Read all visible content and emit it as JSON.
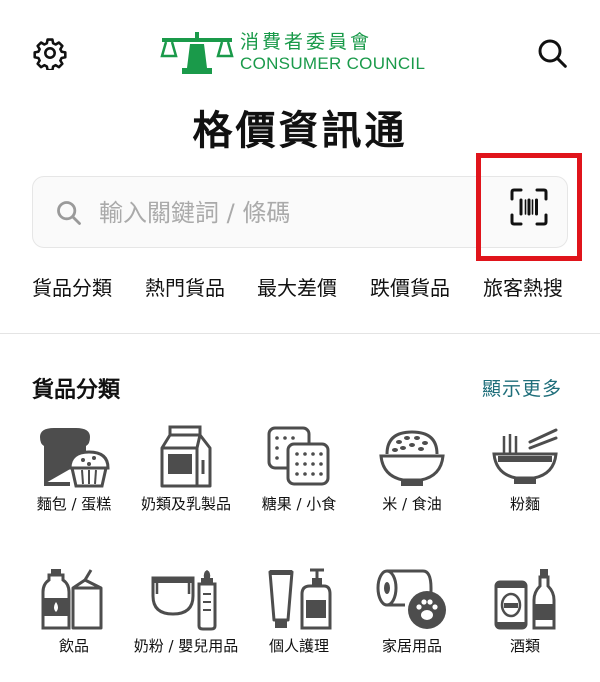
{
  "header": {
    "logo_zh": "消費者委員會",
    "logo_en": "CONSUMER COUNCIL",
    "title": "格價資訊通"
  },
  "search": {
    "placeholder": "輸入關鍵詞 / 條碼"
  },
  "tabs": [
    {
      "label": "貨品分類"
    },
    {
      "label": "熱門貨品"
    },
    {
      "label": "最大差價"
    },
    {
      "label": "跌價貨品"
    },
    {
      "label": "旅客熱搜"
    }
  ],
  "categories_section": {
    "title": "貨品分類",
    "show_more": "顯示更多",
    "items": [
      {
        "label": "麵包 / 蛋糕",
        "icon": "bread-cake-icon"
      },
      {
        "label": "奶類及乳製品",
        "icon": "milk-carton-icon"
      },
      {
        "label": "糖果 / 小食",
        "icon": "crackers-icon"
      },
      {
        "label": "米 / 食油",
        "icon": "rice-bowl-icon"
      },
      {
        "label": "粉麵",
        "icon": "noodle-bowl-icon"
      },
      {
        "label": "飲品",
        "icon": "drinks-icon"
      },
      {
        "label": "奶粉 / 嬰兒用品",
        "icon": "baby-products-icon"
      },
      {
        "label": "個人護理",
        "icon": "personal-care-icon"
      },
      {
        "label": "家居用品",
        "icon": "household-icon"
      },
      {
        "label": "酒類",
        "icon": "alcohol-icon"
      }
    ]
  },
  "colors": {
    "brand_green": "#1a9a4a",
    "link_teal": "#1e6e7a",
    "highlight_red": "#e0141b"
  }
}
